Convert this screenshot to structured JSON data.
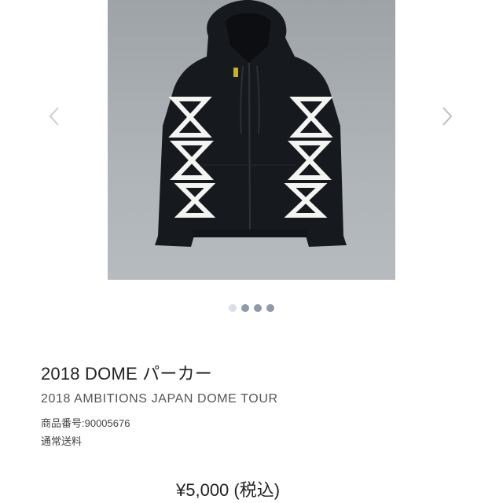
{
  "product": {
    "title": "2018 DOME パーカー",
    "subtitle": "2018 AMBITIONS JAPAN DOME TOUR",
    "code_line": "商品番号:90005676",
    "shipping": "通常送料",
    "price": "¥5,000 (税込)"
  },
  "gallery": {
    "slide_count": 4,
    "active_index": 0,
    "prev_icon": "chevron-left-icon",
    "next_icon": "chevron-right-icon"
  },
  "colors": {
    "photo_bg": "#a9aeb3",
    "hoodie": "#16191d",
    "dot_active": "#d9dfe5",
    "dot_inactive": "#8d9aa8"
  }
}
